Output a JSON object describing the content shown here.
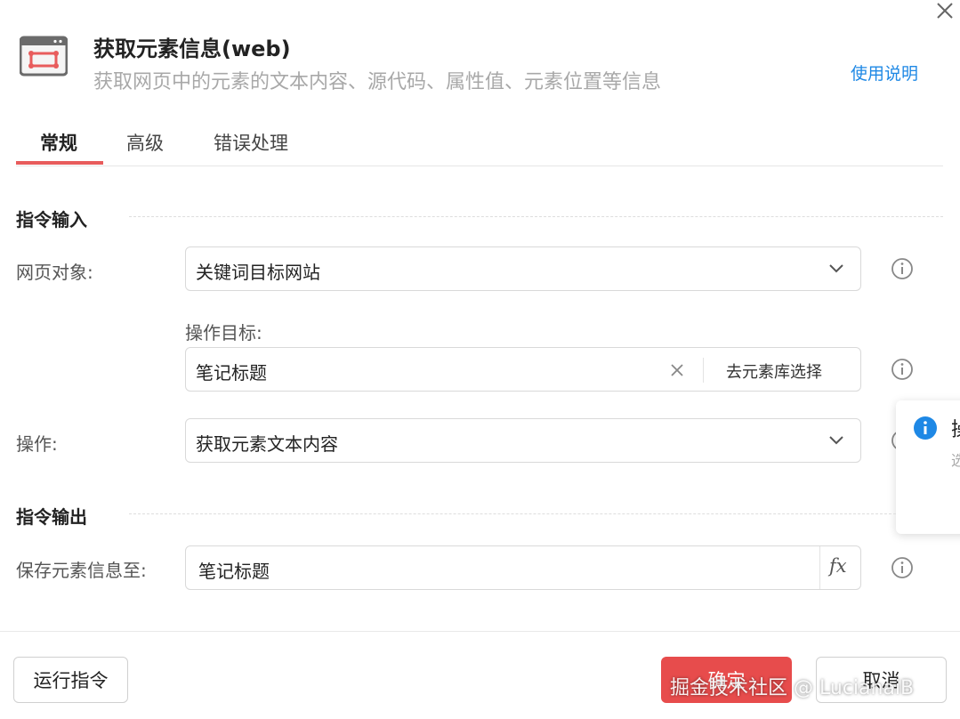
{
  "header": {
    "title": "获取元素信息(web)",
    "subtitle": "获取网页中的元素的文本内容、源代码、属性值、元素位置等信息",
    "help_link": "使用说明",
    "icon": "browser-element-icon"
  },
  "tabs": [
    {
      "label": "常规",
      "active": true
    },
    {
      "label": "高级",
      "active": false
    },
    {
      "label": "错误处理",
      "active": false
    }
  ],
  "sections": {
    "input_title": "指令输入",
    "output_title": "指令输出"
  },
  "fields": {
    "page_object": {
      "label": "网页对象:",
      "value": "关键词目标网站"
    },
    "target": {
      "label": "操作目标:",
      "value": "笔记标题",
      "library_button": "去元素库选择"
    },
    "operation": {
      "label": "操作:",
      "value": "获取元素文本内容"
    },
    "save_to": {
      "label": "保存元素信息至:",
      "value": "笔记标题",
      "fx": "fx"
    }
  },
  "popover": {
    "title": "操",
    "text": "选"
  },
  "footer": {
    "run_label": "运行指令",
    "confirm_label": "确定",
    "cancel_label": "取消"
  },
  "watermark": "掘金技术社区 @ LucianaiB",
  "colors": {
    "accent_red": "#e74c4c",
    "link_blue": "#1e88e5",
    "info_blue": "#1e88e5"
  }
}
